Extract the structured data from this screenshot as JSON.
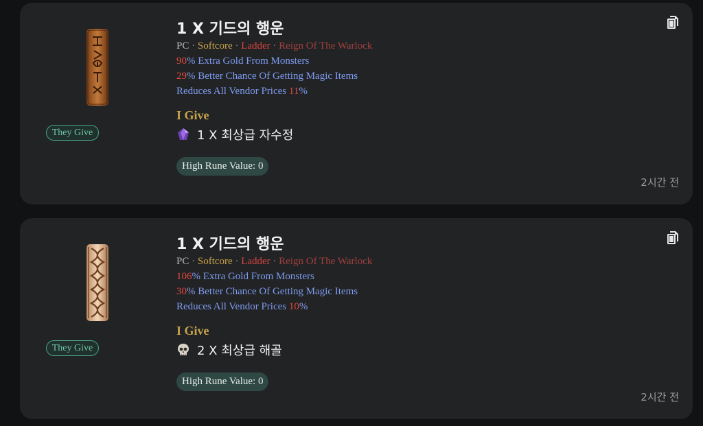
{
  "listings": [
    {
      "title": "1 X 기드의 행운",
      "tags": {
        "platform": "PC",
        "mode": "Softcore",
        "ladder": "Ladder",
        "season": "Reign Of The Warlock",
        "separator": "·"
      },
      "stats": [
        {
          "value": "90",
          "text": "% Extra Gold From Monsters"
        },
        {
          "value": "29",
          "text": "% Better Chance Of Getting Magic Items"
        },
        {
          "prefix": "Reduces All Vendor Prices ",
          "value": "11",
          "suffix": "%"
        }
      ],
      "they_give_label": "They Give",
      "i_give_label": "I Give",
      "give_item": {
        "icon": "amethyst-gem-icon",
        "text": "1 X 최상급 자수정"
      },
      "rune_value": "High Rune Value: 0",
      "timestamp": "2시간 전"
    },
    {
      "title": "1 X 기드의 행운",
      "tags": {
        "platform": "PC",
        "mode": "Softcore",
        "ladder": "Ladder",
        "season": "Reign Of The Warlock",
        "separator": "·"
      },
      "stats": [
        {
          "value": "106",
          "text": "% Extra Gold From Monsters"
        },
        {
          "value": "30",
          "text": "% Better Chance Of Getting Magic Items"
        },
        {
          "prefix": "Reduces All Vendor Prices ",
          "value": "10",
          "suffix": "%"
        }
      ],
      "they_give_label": "They Give",
      "i_give_label": "I Give",
      "give_item": {
        "icon": "skull-icon",
        "text": "2 X 최상급 해골"
      },
      "rune_value": "High Rune Value: 0",
      "timestamp": "2시간 전"
    }
  ],
  "colors": {
    "background": "#111213",
    "card": "#222325",
    "softcore": "#c9a44b",
    "ladder": "#d6433d",
    "stat_text": "#7e9cf0",
    "stat_number": "#e24a3d",
    "they_give_border": "#4aa38c",
    "rune_pill": "#2f4844"
  }
}
